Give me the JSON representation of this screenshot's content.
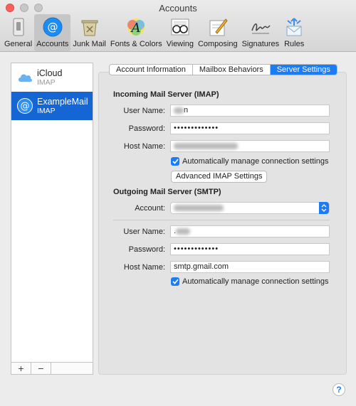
{
  "window": {
    "title": "Accounts"
  },
  "toolbar": {
    "items": [
      {
        "label": "General",
        "icon": "switch-icon"
      },
      {
        "label": "Accounts",
        "icon": "at-sign-icon",
        "active": true
      },
      {
        "label": "Junk Mail",
        "icon": "trash-bin-icon"
      },
      {
        "label": "Fonts & Colors",
        "icon": "font-icon"
      },
      {
        "label": "Viewing",
        "icon": "glasses-icon"
      },
      {
        "label": "Composing",
        "icon": "pencil-icon"
      },
      {
        "label": "Signatures",
        "icon": "signature-icon"
      },
      {
        "label": "Rules",
        "icon": "envelope-arrows-icon"
      }
    ]
  },
  "sidebar": {
    "accounts": [
      {
        "name": "iCloud",
        "type": "IMAP",
        "icon": "cloud-icon"
      },
      {
        "name": "ExampleMail",
        "type": "IMAP",
        "icon": "at-sign-icon",
        "selected": true
      }
    ],
    "add": "+",
    "remove": "−"
  },
  "tabs": [
    "Account Information",
    "Mailbox Behaviors",
    "Server Settings"
  ],
  "incoming": {
    "heading": "Incoming Mail Server (IMAP)",
    "user_label": "User Name:",
    "user_value": "n",
    "password_label": "Password:",
    "password_value": "•••••••••••••",
    "host_label": "Host Name:",
    "auto_manage": "Automatically manage connection settings",
    "advanced_button": "Advanced IMAP Settings"
  },
  "outgoing": {
    "heading": "Outgoing Mail Server (SMTP)",
    "account_label": "Account:",
    "user_label": "User Name:",
    "user_value": ".",
    "password_label": "Password:",
    "password_value": "•••••••••••••",
    "host_label": "Host Name:",
    "host_value": "smtp.gmail.com",
    "auto_manage": "Automatically manage connection settings"
  },
  "help": "?",
  "colors": {
    "accent": "#1b7cf6",
    "selection": "#1565d5"
  }
}
